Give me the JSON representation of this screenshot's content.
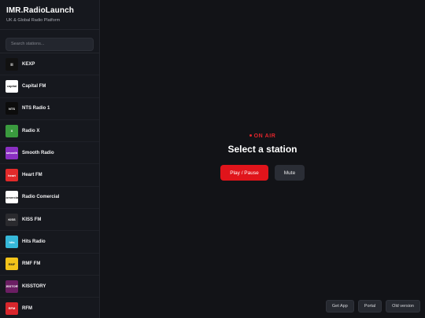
{
  "app": {
    "title": "IMR.RadioLaunch",
    "subtitle": "UK & Global Radio Platform"
  },
  "search": {
    "placeholder": "Search stations..."
  },
  "stations": [
    {
      "name": "KEXP",
      "logo": "kexp-logo",
      "bg": "#111111",
      "mark": "|||"
    },
    {
      "name": "Capital FM",
      "logo": "capital-fm-logo",
      "bg": "#ffffff",
      "mark": "capital"
    },
    {
      "name": "NTS Radio 1",
      "logo": "nts-logo",
      "bg": "#0c0c0c",
      "mark": "NTS"
    },
    {
      "name": "Radio X",
      "logo": "radio-x-logo",
      "bg": "#3a9a3e",
      "mark": "X"
    },
    {
      "name": "Smooth Radio",
      "logo": "smooth-radio-logo",
      "bg": "#8a2fc2",
      "mark": "smooth"
    },
    {
      "name": "Heart FM",
      "logo": "heart-fm-logo",
      "bg": "#e22a2a",
      "mark": "heart"
    },
    {
      "name": "Radio Comercial",
      "logo": "radio-comercial-logo",
      "bg": "#ffffff",
      "mark": "comercial"
    },
    {
      "name": "KISS FM",
      "logo": "kiss-fm-logo",
      "bg": "#2a2a2e",
      "mark": "KISS"
    },
    {
      "name": "Hits Radio",
      "logo": "hits-radio-logo",
      "bg": "#36b8d9",
      "mark": "hits"
    },
    {
      "name": "RMF FM",
      "logo": "rmf-fm-logo",
      "bg": "#f2c31a",
      "mark": "RMF"
    },
    {
      "name": "KISSTORY",
      "logo": "kisstory-logo",
      "bg": "#6b1e63",
      "mark": "KISSTORY"
    },
    {
      "name": "RFM",
      "logo": "rfm-logo",
      "bg": "#d8262c",
      "mark": "RFM"
    }
  ],
  "player": {
    "status": "ON AIR",
    "title": "Select a station",
    "play_label": "Play / Pause",
    "mute_label": "Mute"
  },
  "footer": {
    "get_app": "Get App",
    "portal": "Portal",
    "old_version": "Old version"
  },
  "colors": {
    "accent": "#e0141b",
    "background": "#121317",
    "sidebar": "#16181e"
  }
}
